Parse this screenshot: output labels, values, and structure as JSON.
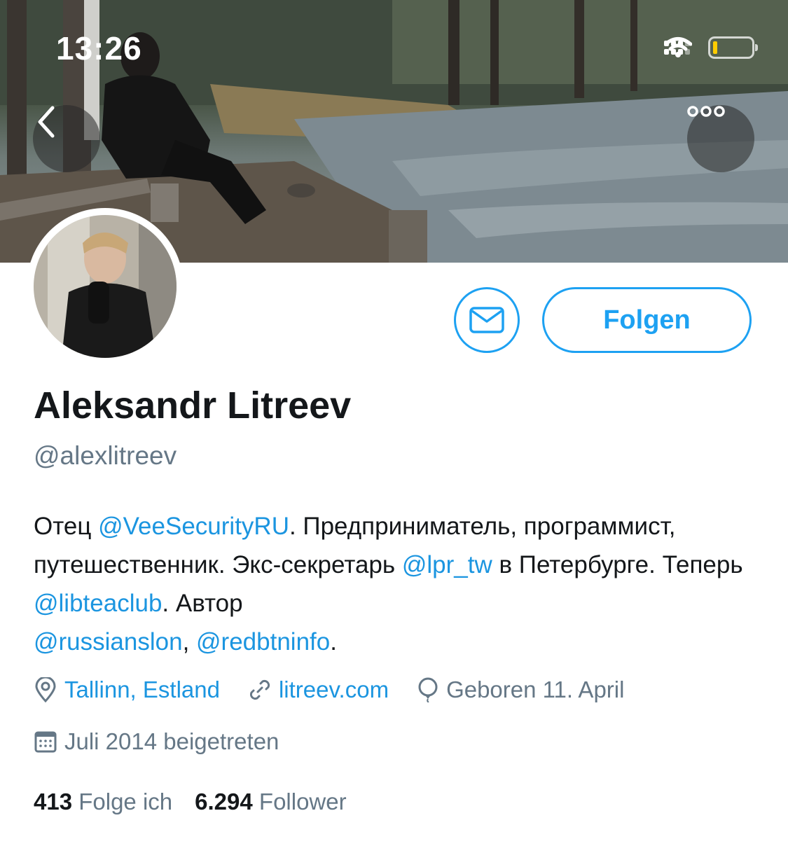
{
  "status_bar": {
    "time": "13:26"
  },
  "profile": {
    "name": "Aleksandr Litreev",
    "handle": "@alexlitreev",
    "bio": {
      "t1": "Отец ",
      "m1": "@VeeSecurityRU",
      "t2": ". Предприниматель, программист, путешественник. Экс-секретарь ",
      "m2": "@lpr_tw",
      "t3": " в Петербурге. Теперь ",
      "m3": "@libteaclub",
      "t4": ". Автор ",
      "m4": "@russianslon",
      "t5": ", ",
      "m5": "@redbtninfo",
      "t6": "."
    },
    "location": "Tallinn, Estland",
    "website": "litreev.com",
    "birthday": "Geboren 11. April",
    "joined": "Juli 2014 beigetreten",
    "following_count": "413",
    "following_label": "Folge ich",
    "followers_count": "6.294",
    "followers_label": "Follower"
  },
  "actions": {
    "follow_label": "Folgen"
  },
  "icons": {
    "back": "chevron-left-icon",
    "more": "more-horizontal-icon",
    "message": "envelope-icon",
    "location": "map-pin-icon",
    "website": "link-icon",
    "birthday": "balloon-icon",
    "joined": "calendar-icon"
  },
  "colors": {
    "accent": "#1da1f2",
    "link": "#1b95e0",
    "secondary_text": "#657786",
    "battery_level": "#ffcc00"
  }
}
